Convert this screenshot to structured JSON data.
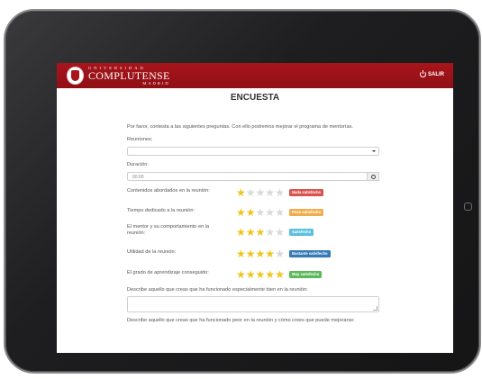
{
  "header": {
    "logo_top": "UNIVERSIDAD",
    "logo_main": "COMPLUTENSE",
    "logo_sub": "MADRID",
    "logout_label": "SALIR",
    "brand_color": "#a8151c"
  },
  "form": {
    "title": "ENCUESTA",
    "intro": "Por favor, contesta a las siguientes preguntas. Con ello podremos mejorar el programa de mentorías.",
    "meetings_label": "Reuniones:",
    "meetings_value": "",
    "duration_label": "Duración:",
    "duration_value": "00:00",
    "ratings": [
      {
        "label": "Contenidos abordados en la reunión:",
        "stars": 1,
        "badge": "Nada satisfecho",
        "color": "#d9534f"
      },
      {
        "label": "Tiempo dedicado a la reunión:",
        "stars": 2,
        "badge": "Poco satisfecho",
        "color": "#f0ad4e"
      },
      {
        "label": "El mentor y su comportamiento en la reunión:",
        "stars": 3,
        "badge": "Satisfecho",
        "color": "#5bc0de"
      },
      {
        "label": "Utilidad de la reunión:",
        "stars": 4,
        "badge": "Bastante satisfecho",
        "color": "#337ab7"
      },
      {
        "label": "El grado de aprendizaje conseguido:",
        "stars": 5,
        "badge": "Muy satisfecho",
        "color": "#5cb85c"
      }
    ],
    "positive_label": "Describe aquello que creas que ha funcionado especialmente bien en la reunión:",
    "positive_value": "",
    "negative_label": "Describe aquello que creas que ha funcionado peor en la reunión y cómo crees que puede mejorarse:"
  }
}
